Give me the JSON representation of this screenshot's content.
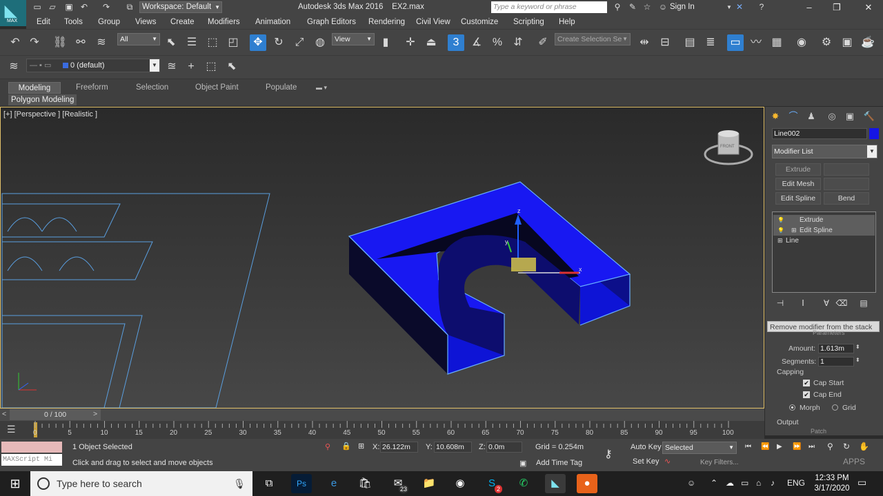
{
  "titlebar": {
    "logo": "MAX",
    "workspace": "Workspace: Default",
    "app_title": "Autodesk 3ds Max 2016",
    "file_name": "EX2.max",
    "search_placeholder": "Type a keyword or phrase",
    "sign_in": "Sign In"
  },
  "menu": [
    "Edit",
    "Tools",
    "Group",
    "Views",
    "Create",
    "Modifiers",
    "Animation",
    "Graph Editors",
    "Rendering",
    "Civil View",
    "Customize",
    "Scripting",
    "Help"
  ],
  "toolbar": {
    "selection_filter": "All",
    "ref_coord": "View",
    "selection_set_placeholder": "Create Selection Se",
    "layer": "0 (default)"
  },
  "ribbon": {
    "tabs": [
      "Modeling",
      "Freeform",
      "Selection",
      "Object Paint",
      "Populate"
    ],
    "active_tab": "Modeling",
    "panel": "Polygon Modeling"
  },
  "viewport": {
    "label": "[+] [Perspective ] [Realistic ]",
    "viewcube": "FRONT"
  },
  "command_panel": {
    "object_name": "Line002",
    "object_color": "#1515e6",
    "modifier_list": "Modifier List",
    "modifier_buttons": [
      "Extrude",
      "",
      "Edit Mesh",
      "",
      "Edit Spline",
      "Bend"
    ],
    "stack": [
      "Extrude",
      "Edit Spline",
      "Line"
    ],
    "tooltip": "Remove modifier from the stack",
    "rollout_title": "Parameters",
    "amount_label": "Amount:",
    "amount": "1.613m",
    "segments_label": "Segments:",
    "segments": "1",
    "capping_label": "Capping",
    "cap_start": "Cap Start",
    "cap_end": "Cap End",
    "morph": "Morph",
    "grid": "Grid",
    "output_label": "Output",
    "patch": "Patch"
  },
  "timeline": {
    "slider": "0 / 100",
    "ticks": [
      "0",
      "5",
      "10",
      "15",
      "20",
      "25",
      "30",
      "35",
      "40",
      "45",
      "50",
      "55",
      "60",
      "65",
      "70",
      "75",
      "80",
      "85",
      "90",
      "95",
      "100"
    ]
  },
  "status": {
    "listener": "MAXScript Mi",
    "selected": "1 Object Selected",
    "prompt": "Click and drag to select and move objects",
    "x_label": "X:",
    "x": "26.122m",
    "y_label": "Y:",
    "y": "10.608m",
    "z_label": "Z:",
    "z": "0.0m",
    "grid": "Grid = 0.254m",
    "add_time_tag": "Add Time Tag",
    "auto_key": "Auto Key",
    "auto_key_value": "Selected",
    "set_key": "Set Key",
    "key_filters": "Key Filters..."
  },
  "taskbar": {
    "search": "Type here to search",
    "mail_badge": "23",
    "skype_badge": "2",
    "lang": "ENG",
    "time": "12:33 PM",
    "date": "3/17/2020"
  },
  "watermark": "APPS"
}
